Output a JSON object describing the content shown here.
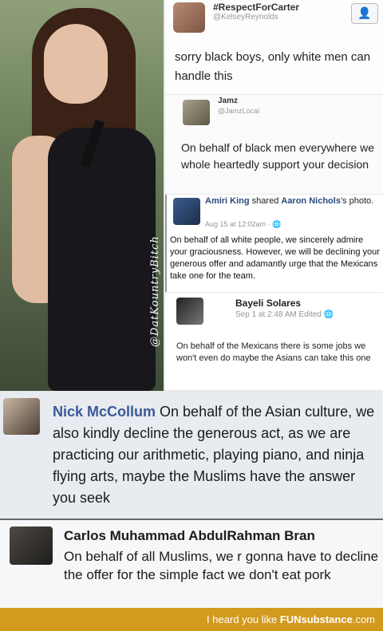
{
  "photo": {
    "watermark": "@DatKountryBitch"
  },
  "tweet1": {
    "name": "#RespectForCarter",
    "handle": "@KelseyReynolds",
    "follow_icon": "follow-person-icon",
    "text": "sorry black boys, only white men can handle this"
  },
  "tweet2": {
    "name": "Jamz",
    "handle": "@JamzLocal",
    "text": "On behalf of black men everywhere we whole heartedly support your decision"
  },
  "fb1": {
    "actor": "Amiri King",
    "shared": " shared ",
    "target": "Aaron Nichols",
    "suffix": "'s photo.",
    "time": "Aug 15 at 12:02am · ",
    "text": "On behalf of all white people, we sincerely admire your graciousness. However, we will be declining your generous offer and adamantly urge that the Mexicans take one for the team."
  },
  "fb2": {
    "name": "Bayeli Solares",
    "time": "Sep 1 at 2:48 AM Edited",
    "text": "On behalf of the Mexicans there is some jobs we won't even do maybe the Asians can take this one"
  },
  "nick": {
    "name": "Nick McCollum",
    "text": " On behalf of the Asian culture, we also kindly decline the generous act, as we are practicing our arithmetic, playing piano, and ninja flying arts, maybe the Muslims have the answer you seek"
  },
  "carlos": {
    "name": "Carlos Muhammad AbdulRahman Bran",
    "text": "On behalf of all Muslims, we r gonna have to decline the offer for the simple fact we don't eat pork"
  },
  "footer": {
    "prefix": "I heard you like ",
    "brand": "FUNsubstance",
    "suffix": ".com"
  },
  "colors": {
    "footer_bg": "#d29a1f",
    "fb_link": "#3b5998"
  }
}
